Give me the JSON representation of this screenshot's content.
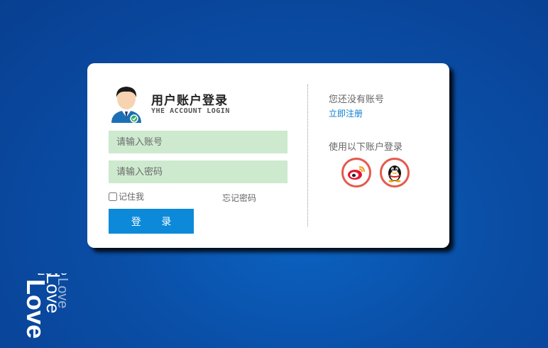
{
  "login": {
    "title": "用户账户登录",
    "subtitle": "YHE ACCOUNT LOGIN",
    "account_placeholder": "请输入账号",
    "password_placeholder": "请输入密码",
    "remember_label": "记住我",
    "forgot_label": "忘记密码",
    "login_button": "登 录"
  },
  "register": {
    "prompt": "您还没有账号",
    "link": "立即注册"
  },
  "social": {
    "label": "使用以下账户登录",
    "providers": [
      {
        "name": "weibo",
        "icon": "weibo-icon"
      },
      {
        "name": "qq",
        "icon": "qq-icon"
      }
    ],
    "ring_color": "#e55a4e"
  },
  "decor": {
    "text": "Love"
  },
  "colors": {
    "accent": "#0c8ad9",
    "input_bg": "#cdeacf",
    "background": "#0a4ea6"
  }
}
